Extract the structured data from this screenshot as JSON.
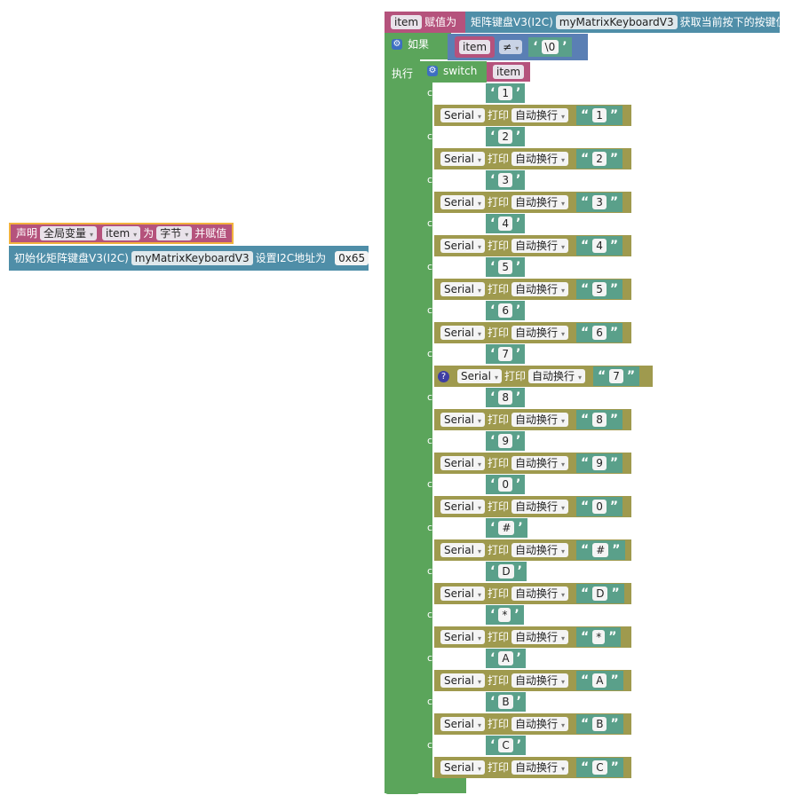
{
  "colors": {
    "variable": "#b5527c",
    "keyboard": "#4f8ea8",
    "logic": "#5a7fb4",
    "control": "#5ba55b",
    "text": "#5aa08a",
    "serial": "#9f9a4e",
    "declare_highlight": "#f2b23e"
  },
  "declare": {
    "label": "声明",
    "scope": "全局变量",
    "var": "item",
    "as": "为",
    "type": "字节",
    "assign": "并赋值"
  },
  "init": {
    "label": "初始化矩阵键盘V3(I2C)",
    "instance": "myMatrixKeyboardV3",
    "addr_label": "设置I2C地址为",
    "addr": "0x65"
  },
  "assign": {
    "var": "item",
    "label": "赋值为",
    "source": "矩阵键盘V3(I2C)",
    "instance": "myMatrixKeyboardV3",
    "action": "获取当前按下的按键值"
  },
  "if_block": {
    "label": "如果",
    "var": "item",
    "op": "≠",
    "value": "\\0",
    "do_label": "执行"
  },
  "switch_block": {
    "label": "switch",
    "var": "item",
    "case_label": "case"
  },
  "serial": {
    "port": "Serial",
    "print": "打印",
    "mode": "自动换行"
  },
  "cases": [
    {
      "key": "1",
      "out": "1"
    },
    {
      "key": "2",
      "out": "2"
    },
    {
      "key": "3",
      "out": "3"
    },
    {
      "key": "4",
      "out": "4"
    },
    {
      "key": "5",
      "out": "5"
    },
    {
      "key": "6",
      "out": "6"
    },
    {
      "key": "7",
      "out": "7"
    },
    {
      "key": "8",
      "out": "8"
    },
    {
      "key": "9",
      "out": "9"
    },
    {
      "key": "0",
      "out": "0"
    },
    {
      "key": "#",
      "out": "#"
    },
    {
      "key": "D",
      "out": "D"
    },
    {
      "key": "*",
      "out": "*"
    },
    {
      "key": "A",
      "out": "A"
    },
    {
      "key": "B",
      "out": "B"
    },
    {
      "key": "C",
      "out": "C"
    }
  ]
}
